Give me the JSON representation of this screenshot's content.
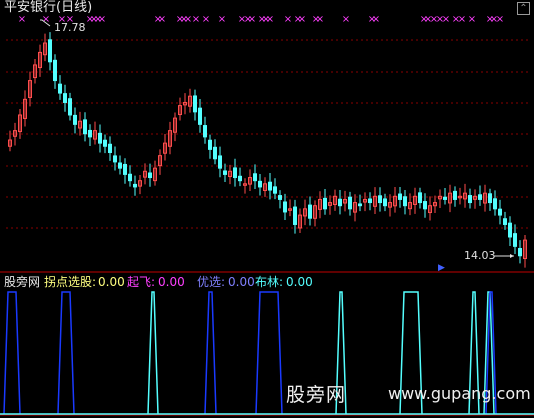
{
  "header": {
    "title": "平安银行(日线)"
  },
  "colors": {
    "bg": "#000000",
    "up": "#ff4d4d",
    "down": "#54ffff",
    "grid": "#8a0000",
    "signal": "#ff40ff",
    "blue": "#1a3aff",
    "cyan": "#54ffff",
    "label_yellow": "#ffff80",
    "magenta": "#ff40ff",
    "purple": "#8080ff"
  },
  "indicator_bar": {
    "name": "股旁网",
    "items": [
      {
        "label": "拐点选股:",
        "value": "0.00",
        "color": "#ffff80"
      },
      {
        "label": "起飞:",
        "value": "0.00",
        "color": "#ff40ff"
      },
      {
        "label": "优选:",
        "value": "0.00",
        "color": "#8080ff"
      },
      {
        "label": "布林:",
        "value": "0.00",
        "color": "#54ffff"
      }
    ]
  },
  "watermark": {
    "cn": "股旁网",
    "en": "www.gupang.com"
  },
  "corner_icon": "close-icon",
  "chart_data": [
    {
      "type": "candlestick",
      "title": "平安银行(日线)",
      "high_label": "17.78",
      "low_label": "14.03",
      "close": [
        15.95,
        16.1,
        16.35,
        16.6,
        16.9,
        17.15,
        17.35,
        17.5,
        17.2,
        16.9,
        16.7,
        16.55,
        16.35,
        16.2,
        16.25,
        16.05,
        16.0,
        16.1,
        15.9,
        15.85,
        15.75,
        15.6,
        15.5,
        15.4,
        15.3,
        15.2,
        15.3,
        15.45,
        15.35,
        15.5,
        15.7,
        15.9,
        16.1,
        16.3,
        16.5,
        16.55,
        16.65,
        16.4,
        16.2,
        16.0,
        15.8,
        15.65,
        15.5,
        15.4,
        15.45,
        15.35,
        15.3,
        15.25,
        15.35,
        15.3,
        15.2,
        15.25,
        15.15,
        15.1,
        15.0,
        14.8,
        14.85,
        14.6,
        14.75,
        14.85,
        14.7,
        14.9,
        15.0,
        14.85,
        14.95,
        15.05,
        14.9,
        15.0,
        14.85,
        14.95,
        14.9,
        15.0,
        14.95,
        15.05,
        14.95,
        14.9,
        14.95,
        15.05,
        15.0,
        14.9,
        14.95,
        15.05,
        14.95,
        14.85,
        14.9,
        14.95,
        15.05,
        15.0,
        15.1,
        15.0,
        15.05,
        15.1,
        14.95,
        15.05,
        15.0,
        15.1,
        14.95,
        14.85,
        14.75,
        14.6,
        14.4,
        14.25,
        14.1,
        14.35
      ],
      "markers": "pink x signals along the top row"
    },
    {
      "type": "line",
      "series": [
        {
          "name": "拐点选股",
          "values": []
        },
        {
          "name": "起飞",
          "values": []
        },
        {
          "name": "优选",
          "values": []
        },
        {
          "name": "布林",
          "values": []
        }
      ],
      "note_values": "indicator pulses between 0 and 1"
    }
  ]
}
